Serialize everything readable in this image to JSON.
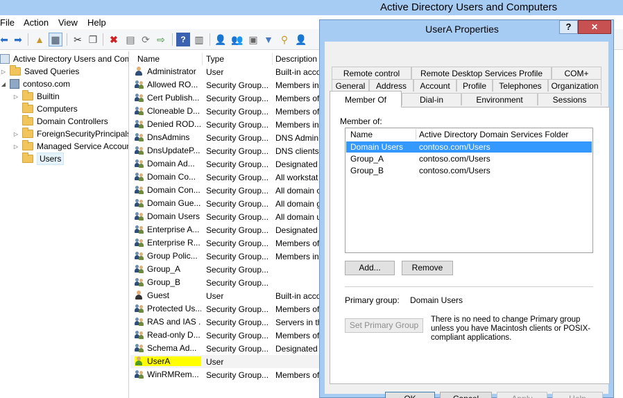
{
  "main": {
    "title": "Active Directory Users and Computers",
    "menu": [
      "File",
      "Action",
      "View",
      "Help"
    ]
  },
  "tree": {
    "root": "Active Directory Users and Com",
    "saved_queries": "Saved Queries",
    "domain": "contoso.com",
    "children": [
      "Builtin",
      "Computers",
      "Domain Controllers",
      "ForeignSecurityPrincipals",
      "Managed Service Accoun",
      "Users"
    ]
  },
  "list": {
    "columns": [
      "Name",
      "Type",
      "Description"
    ],
    "rows": [
      {
        "name": "Administrator",
        "type": "User",
        "desc": "Built-in acco",
        "kind": "user"
      },
      {
        "name": "Allowed RO...",
        "type": "Security Group...",
        "desc": "Members in",
        "kind": "group"
      },
      {
        "name": "Cert Publish...",
        "type": "Security Group...",
        "desc": "Members of",
        "kind": "group"
      },
      {
        "name": "Cloneable D...",
        "type": "Security Group...",
        "desc": "Members of",
        "kind": "group"
      },
      {
        "name": "Denied ROD...",
        "type": "Security Group...",
        "desc": "Members in",
        "kind": "group"
      },
      {
        "name": "DnsAdmins",
        "type": "Security Group...",
        "desc": "DNS Admin",
        "kind": "group"
      },
      {
        "name": "DnsUpdateP...",
        "type": "Security Group...",
        "desc": "DNS clients",
        "kind": "group"
      },
      {
        "name": "Domain Ad...",
        "type": "Security Group...",
        "desc": "Designated",
        "kind": "group"
      },
      {
        "name": "Domain Co...",
        "type": "Security Group...",
        "desc": "All workstat",
        "kind": "group"
      },
      {
        "name": "Domain Con...",
        "type": "Security Group...",
        "desc": "All domain c",
        "kind": "group"
      },
      {
        "name": "Domain Gue...",
        "type": "Security Group...",
        "desc": "All domain g",
        "kind": "group"
      },
      {
        "name": "Domain Users",
        "type": "Security Group...",
        "desc": "All domain u",
        "kind": "group"
      },
      {
        "name": "Enterprise A...",
        "type": "Security Group...",
        "desc": "Designated",
        "kind": "group"
      },
      {
        "name": "Enterprise R...",
        "type": "Security Group...",
        "desc": "Members of",
        "kind": "group"
      },
      {
        "name": "Group Polic...",
        "type": "Security Group...",
        "desc": "Members in",
        "kind": "group"
      },
      {
        "name": "Group_A",
        "type": "Security Group...",
        "desc": "",
        "kind": "group"
      },
      {
        "name": "Group_B",
        "type": "Security Group...",
        "desc": "",
        "kind": "group"
      },
      {
        "name": "Guest",
        "type": "User",
        "desc": "Built-in acco",
        "kind": "user-disabled"
      },
      {
        "name": "Protected Us...",
        "type": "Security Group...",
        "desc": "Members of",
        "kind": "group"
      },
      {
        "name": "RAS and IAS ...",
        "type": "Security Group...",
        "desc": "Servers in th",
        "kind": "group"
      },
      {
        "name": "Read-only D...",
        "type": "Security Group...",
        "desc": "Members of",
        "kind": "group"
      },
      {
        "name": "Schema Ad...",
        "type": "Security Group...",
        "desc": "Designated",
        "kind": "group"
      },
      {
        "name": "UserA",
        "type": "User",
        "desc": "",
        "kind": "user-green"
      },
      {
        "name": "WinRMRem...",
        "type": "Security Group...",
        "desc": "Members of",
        "kind": "group"
      }
    ]
  },
  "dialog": {
    "title": "UserA Properties",
    "help": "?",
    "close": "✕",
    "tabs_row1": [
      "Remote control",
      "Remote Desktop Services Profile",
      "COM+"
    ],
    "tabs_row2": [
      "General",
      "Address",
      "Account",
      "Profile",
      "Telephones",
      "Organization"
    ],
    "tabs_row3": [
      "Member Of",
      "Dial-in",
      "Environment",
      "Sessions"
    ],
    "member_of_label": "Member of:",
    "member_columns": [
      "Name",
      "Active Directory Domain Services Folder"
    ],
    "members": [
      {
        "name": "Domain Users",
        "folder": "contoso.com/Users"
      },
      {
        "name": "Group_A",
        "folder": "contoso.com/Users"
      },
      {
        "name": "Group_B",
        "folder": "contoso.com/Users"
      }
    ],
    "add_button": "Add...",
    "remove_button": "Remove",
    "primary_group_label": "Primary group:",
    "primary_group_value": "Domain Users",
    "set_primary_button": "Set Primary Group",
    "primary_note": "There is no need to change Primary group unless you have Macintosh clients or POSIX-compliant applications.",
    "ok": "OK",
    "cancel": "Cancel",
    "apply": "Apply",
    "help_button": "Help"
  },
  "colors": {
    "titlebar": "#a7ccf3",
    "selection": "#3399ff",
    "highlight": "#ffff00",
    "close": "#c75050"
  }
}
